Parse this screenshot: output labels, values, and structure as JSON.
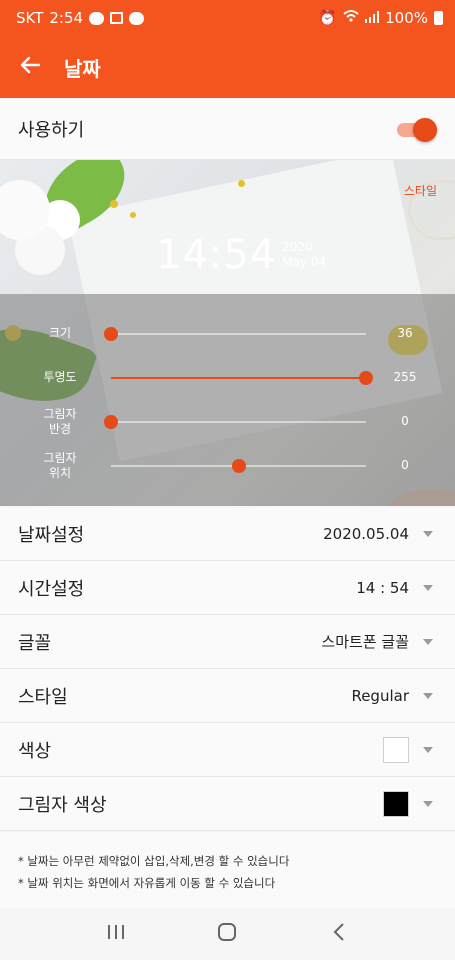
{
  "status_bar": {
    "carrier": "SKT",
    "time": "2:54",
    "battery": "100%"
  },
  "app_bar": {
    "title": "날짜",
    "back_icon": "arrow-left-icon"
  },
  "use_toggle": {
    "label": "사용하기",
    "enabled": true
  },
  "preview": {
    "style_link": "스타일",
    "clock_time": "14:54",
    "date_year": "2020",
    "date_monthday": "May 04"
  },
  "sliders": [
    {
      "label": "크기",
      "value": "36",
      "fraction": 0.0
    },
    {
      "label": "투명도",
      "value": "255",
      "fraction": 1.0
    },
    {
      "label": "그림자\n반경",
      "value": "0",
      "fraction": 0.0
    },
    {
      "label": "그림자\n위치",
      "value": "0",
      "fraction": 0.5
    }
  ],
  "settings": [
    {
      "label": "날짜설정",
      "value": "2020.05.04"
    },
    {
      "label": "시간설정",
      "value": "14 : 54"
    },
    {
      "label": "글꼴",
      "value": "스마트폰 글꼴"
    },
    {
      "label": "스타일",
      "value": "Regular"
    },
    {
      "label": "색상",
      "swatch": "#ffffff"
    },
    {
      "label": "그림자 색상",
      "swatch": "#000000"
    }
  ],
  "notes": [
    "* 날짜는 아무런 제약없이 삽입,삭제,변경 할 수 있습니다",
    "* 날짜 위치는 화면에서 자유롭게 이동 할 수 있습니다"
  ],
  "colors": {
    "accent": "#f4541e",
    "thumb": "#e64a19"
  }
}
